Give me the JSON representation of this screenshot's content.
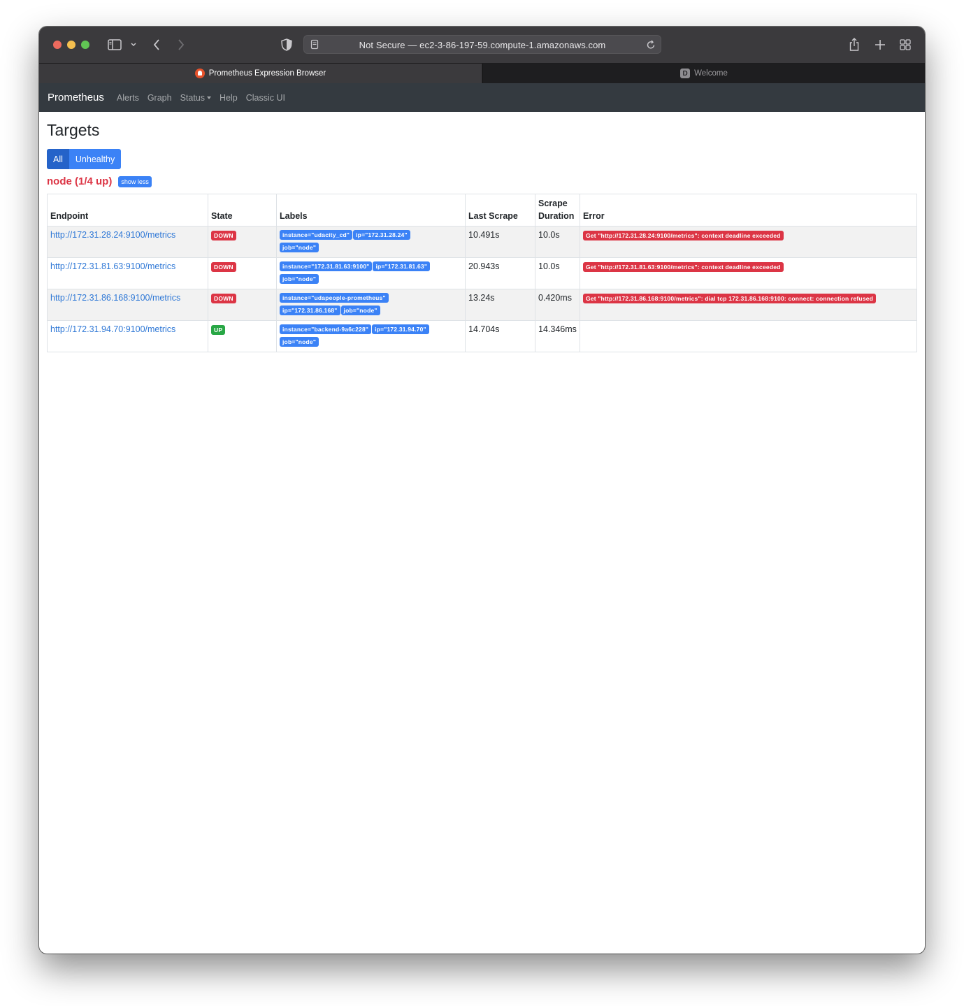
{
  "browser": {
    "url_text": "Not Secure — ec2-3-86-197-59.compute-1.amazonaws.com",
    "tabs": [
      {
        "label": "Prometheus Expression Browser",
        "active": true
      },
      {
        "label": "Welcome",
        "favicon_letter": "D",
        "active": false
      }
    ]
  },
  "navbar": {
    "brand": "Prometheus",
    "links": [
      "Alerts",
      "Graph",
      "Status",
      "Help",
      "Classic UI"
    ]
  },
  "page": {
    "title": "Targets",
    "filter": {
      "all": "All",
      "unhealthy": "Unhealthy"
    },
    "pool": {
      "title": "node (1/4 up)",
      "toggle": "show less"
    }
  },
  "table": {
    "headers": {
      "endpoint": "Endpoint",
      "state": "State",
      "labels": "Labels",
      "last_scrape": "Last Scrape",
      "scrape_duration_1": "Scrape",
      "scrape_duration_2": "Duration",
      "error": "Error"
    },
    "rows": [
      {
        "endpoint": "http://172.31.28.24:9100/metrics",
        "state": "DOWN",
        "labels": [
          "instance=\"udacity_cd\"",
          "ip=\"172.31.28.24\"",
          "job=\"node\""
        ],
        "last_scrape": "10.491s",
        "duration": "10.0s",
        "error": "Get \"http://172.31.28.24:9100/metrics\": context deadline exceeded"
      },
      {
        "endpoint": "http://172.31.81.63:9100/metrics",
        "state": "DOWN",
        "labels": [
          "instance=\"172.31.81.63:9100\"",
          "ip=\"172.31.81.63\"",
          "job=\"node\""
        ],
        "last_scrape": "20.943s",
        "duration": "10.0s",
        "error": "Get \"http://172.31.81.63:9100/metrics\": context deadline exceeded"
      },
      {
        "endpoint": "http://172.31.86.168:9100/metrics",
        "state": "DOWN",
        "labels": [
          "instance=\"udapeople-prometheus\"",
          "ip=\"172.31.86.168\"",
          "job=\"node\""
        ],
        "last_scrape": "13.24s",
        "duration": "0.420ms",
        "error": "Get \"http://172.31.86.168:9100/metrics\": dial tcp 172.31.86.168:9100: connect: connection refused"
      },
      {
        "endpoint": "http://172.31.94.70:9100/metrics",
        "state": "UP",
        "labels": [
          "instance=\"backend-9a6c228\"",
          "ip=\"172.31.94.70\"",
          "job=\"node\""
        ],
        "last_scrape": "14.704s",
        "duration": "14.346ms",
        "error": ""
      }
    ]
  }
}
